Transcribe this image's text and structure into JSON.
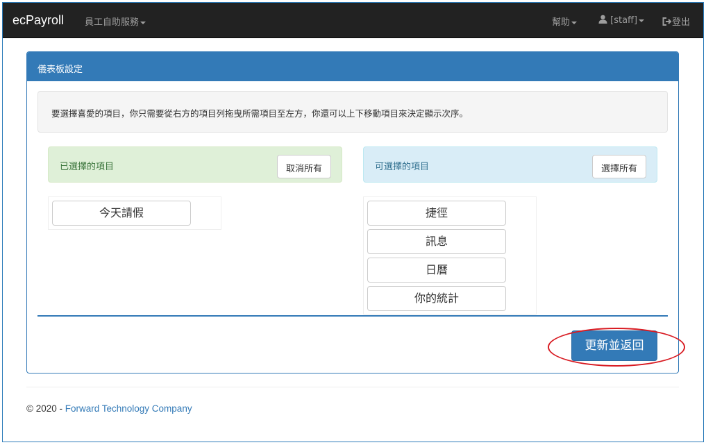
{
  "navbar": {
    "brand": "ecPayroll",
    "self_service": "員工自助服務",
    "help": "幫助",
    "user": "[staff]",
    "logout": "登出"
  },
  "panel": {
    "title": "儀表板設定",
    "instructions": "要選擇喜愛的項目，你只需要從右方的項目列拖曳所需項目至左方，你還可以上下移動項目來決定顯示次序。",
    "selected_title": "已選擇的項目",
    "deselect_all": "取消所有",
    "available_title": "可選擇的項目",
    "select_all": "選擇所有",
    "selected_items": [
      "今天請假"
    ],
    "available_items": [
      "捷徑",
      "訊息",
      "日曆",
      "你的統計"
    ],
    "update_button": "更新並返回"
  },
  "footer": {
    "copyright": "© 2020 - ",
    "company": "Forward Technology Company"
  },
  "colors": {
    "primary": "#337ab7",
    "navbar": "#222222",
    "annotation": "#d81b22"
  }
}
